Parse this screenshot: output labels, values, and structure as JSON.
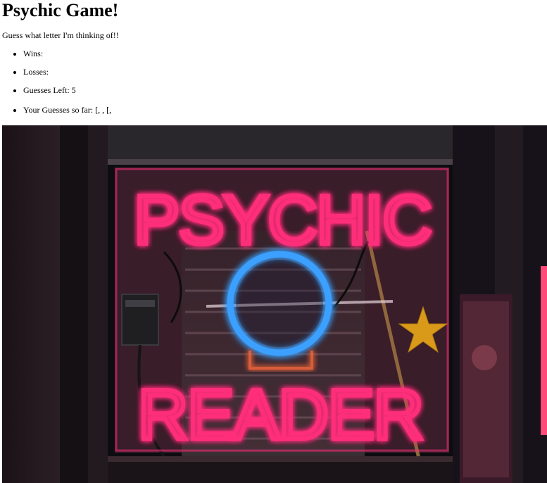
{
  "page": {
    "title": "Psychic Game!",
    "subtitle": "Guess what letter I'm thinking of!!"
  },
  "stats": {
    "wins_label": "Wins:",
    "losses_label": "Losses:",
    "guesses_left_label": "Guesses Left: 5",
    "your_guesses_label": "Your Guesses so far: [,   , [,"
  },
  "image": {
    "sign_top": "PSYCHIC",
    "sign_bottom": "READER",
    "colors": {
      "neon_pink": "#ff2d7a",
      "neon_blue": "#3aa0ff",
      "star": "#d99a1a",
      "background": "#0d0c10"
    }
  }
}
